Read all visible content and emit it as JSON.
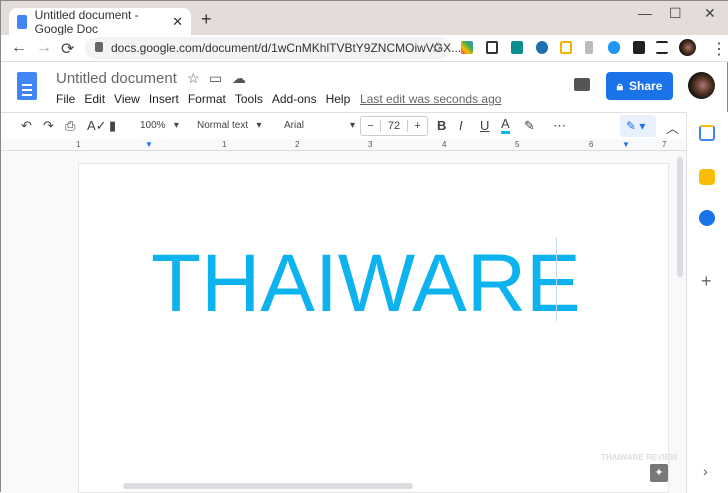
{
  "browser": {
    "tab_title": "Untitled document - Google Doc",
    "new_tab": "+",
    "url": "docs.google.com/document/d/1wCnMKhlTVBtY9ZNCMOiwVGX...",
    "min": "—",
    "max": "☐",
    "close": "✕",
    "back": "←",
    "forward": "→",
    "reload": "⟳",
    "menu": "⋮"
  },
  "docs": {
    "title": "Untitled document",
    "menu": [
      "File",
      "Edit",
      "View",
      "Insert",
      "Format",
      "Tools",
      "Add-ons",
      "Help"
    ],
    "last_edit": "Last edit was seconds ago",
    "share": "Share"
  },
  "toolbar": {
    "zoom": "100%",
    "style": "Normal text",
    "font": "Arial",
    "size": "72",
    "minus": "−",
    "plus": "+",
    "bold": "B",
    "italic": "I",
    "underline": "U",
    "color": "A",
    "more": "⋯"
  },
  "ruler": [
    "1",
    "1",
    "2",
    "3",
    "4",
    "5",
    "6",
    "7"
  ],
  "content": {
    "text": "THAIWARE",
    "text_color": "#0db3ef"
  },
  "watermark": "THAIWARE REVIEW"
}
